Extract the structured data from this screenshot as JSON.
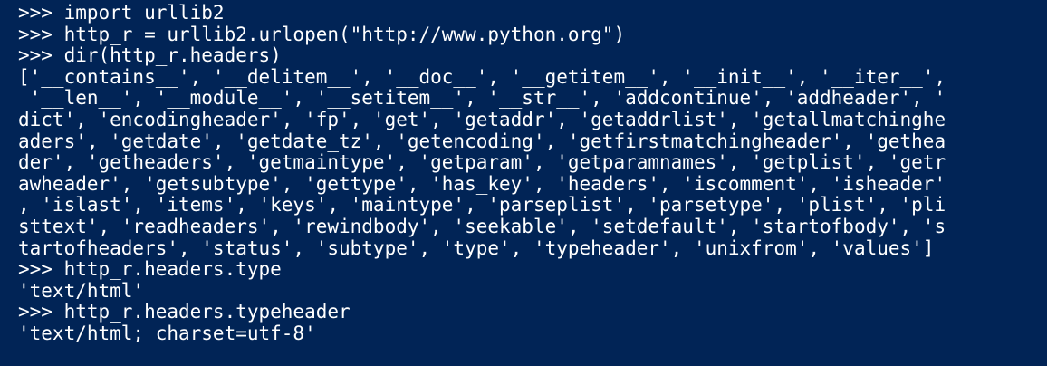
{
  "terminal": {
    "background": "#012456",
    "foreground": "#ffffff",
    "lines": [
      ">>> import urllib2",
      ">>> http_r = urllib2.urlopen(\"http://www.python.org\")",
      ">>> dir(http_r.headers)",
      "['__contains__', '__delitem__', '__doc__', '__getitem__', '__init__', '__iter__',",
      " '__len__', '__module__', '__setitem__', '__str__', 'addcontinue', 'addheader', '",
      "dict', 'encodingheader', 'fp', 'get', 'getaddr', 'getaddrlist', 'getallmatchinghe",
      "aders', 'getdate', 'getdate_tz', 'getencoding', 'getfirstmatchingheader', 'gethea",
      "der', 'getheaders', 'getmaintype', 'getparam', 'getparamnames', 'getplist', 'getr",
      "awheader', 'getsubtype', 'gettype', 'has_key', 'headers', 'iscomment', 'isheader'",
      ", 'islast', 'items', 'keys', 'maintype', 'parseplist', 'parsetype', 'plist', 'pli",
      "sttext', 'readheaders', 'rewindbody', 'seekable', 'setdefault', 'startofbody', 's",
      "tartofheaders', 'status', 'subtype', 'type', 'typeheader', 'unixfrom', 'values']",
      ">>> http_r.headers.type",
      "'text/html'",
      ">>> http_r.headers.typeheader",
      "'text/html; charset=utf-8'"
    ]
  }
}
